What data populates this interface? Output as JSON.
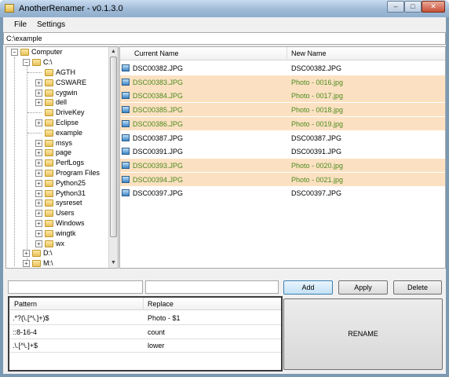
{
  "window": {
    "title": "AnotherRenamer - v0.1.3.0",
    "controls": {
      "minimize": "–",
      "maximize": "□",
      "close": "✕"
    }
  },
  "menu": {
    "file": "File",
    "settings": "Settings"
  },
  "path": {
    "value": "C:\\example"
  },
  "tree": {
    "root": "Computer",
    "drive_c": "C:\\",
    "folders": [
      "AGTH",
      "CSWARE",
      "cygwin",
      "dell",
      "DriveKey",
      "Eclipse",
      "example",
      "msys",
      "page",
      "PerfLogs",
      "Program Files",
      "Python25",
      "Python31",
      "sysreset",
      "Users",
      "Windows",
      "wingtk",
      "wx"
    ],
    "drives": [
      "D:\\",
      "M:\\"
    ],
    "scroll_up": "▲",
    "scroll_down": "▼",
    "expand_glyph": "+",
    "collapse_glyph": "−"
  },
  "filelist": {
    "headers": {
      "current": "Current Name",
      "new": "New Name"
    },
    "rows": [
      {
        "current": "DSC00382.JPG",
        "new": "DSC00382.JPG",
        "highlighted": false
      },
      {
        "current": "DSC00383.JPG",
        "new": "Photo - 0016.jpg",
        "highlighted": true
      },
      {
        "current": "DSC00384.JPG",
        "new": "Photo - 0017.jpg",
        "highlighted": true
      },
      {
        "current": "DSC00385.JPG",
        "new": "Photo - 0018.jpg",
        "highlighted": true
      },
      {
        "current": "DSC00386.JPG",
        "new": "Photo - 0019.jpg",
        "highlighted": true
      },
      {
        "current": "DSC00387.JPG",
        "new": "DSC00387.JPG",
        "highlighted": false
      },
      {
        "current": "DSC00391.JPG",
        "new": "DSC00391.JPG",
        "highlighted": false
      },
      {
        "current": "DSC00393.JPG",
        "new": "Photo - 0020.jpg",
        "highlighted": true
      },
      {
        "current": "DSC00394.JPG",
        "new": "Photo - 0021.jpg",
        "highlighted": true
      },
      {
        "current": "DSC00397.JPG",
        "new": "DSC00397.JPG",
        "highlighted": false
      }
    ]
  },
  "inputs": {
    "pattern_value": "",
    "replace_value": ""
  },
  "buttons": {
    "add": "Add",
    "apply": "Apply",
    "delete": "Delete",
    "rename": "RENAME"
  },
  "patterns": {
    "headers": {
      "pattern": "Pattern",
      "replace": "Replace"
    },
    "rows": [
      {
        "pattern": ".*?(\\.[^\\.]+)$",
        "replace": "Photo - $1"
      },
      {
        "pattern": "::8-16-4",
        "replace": "count"
      },
      {
        "pattern": ".\\.[^\\.]+$",
        "replace": "lower"
      }
    ]
  },
  "colors": {
    "highlight_row": "#fbe1c2",
    "highlight_text": "#4e8a1e",
    "title_bar": "#9fbad6"
  }
}
